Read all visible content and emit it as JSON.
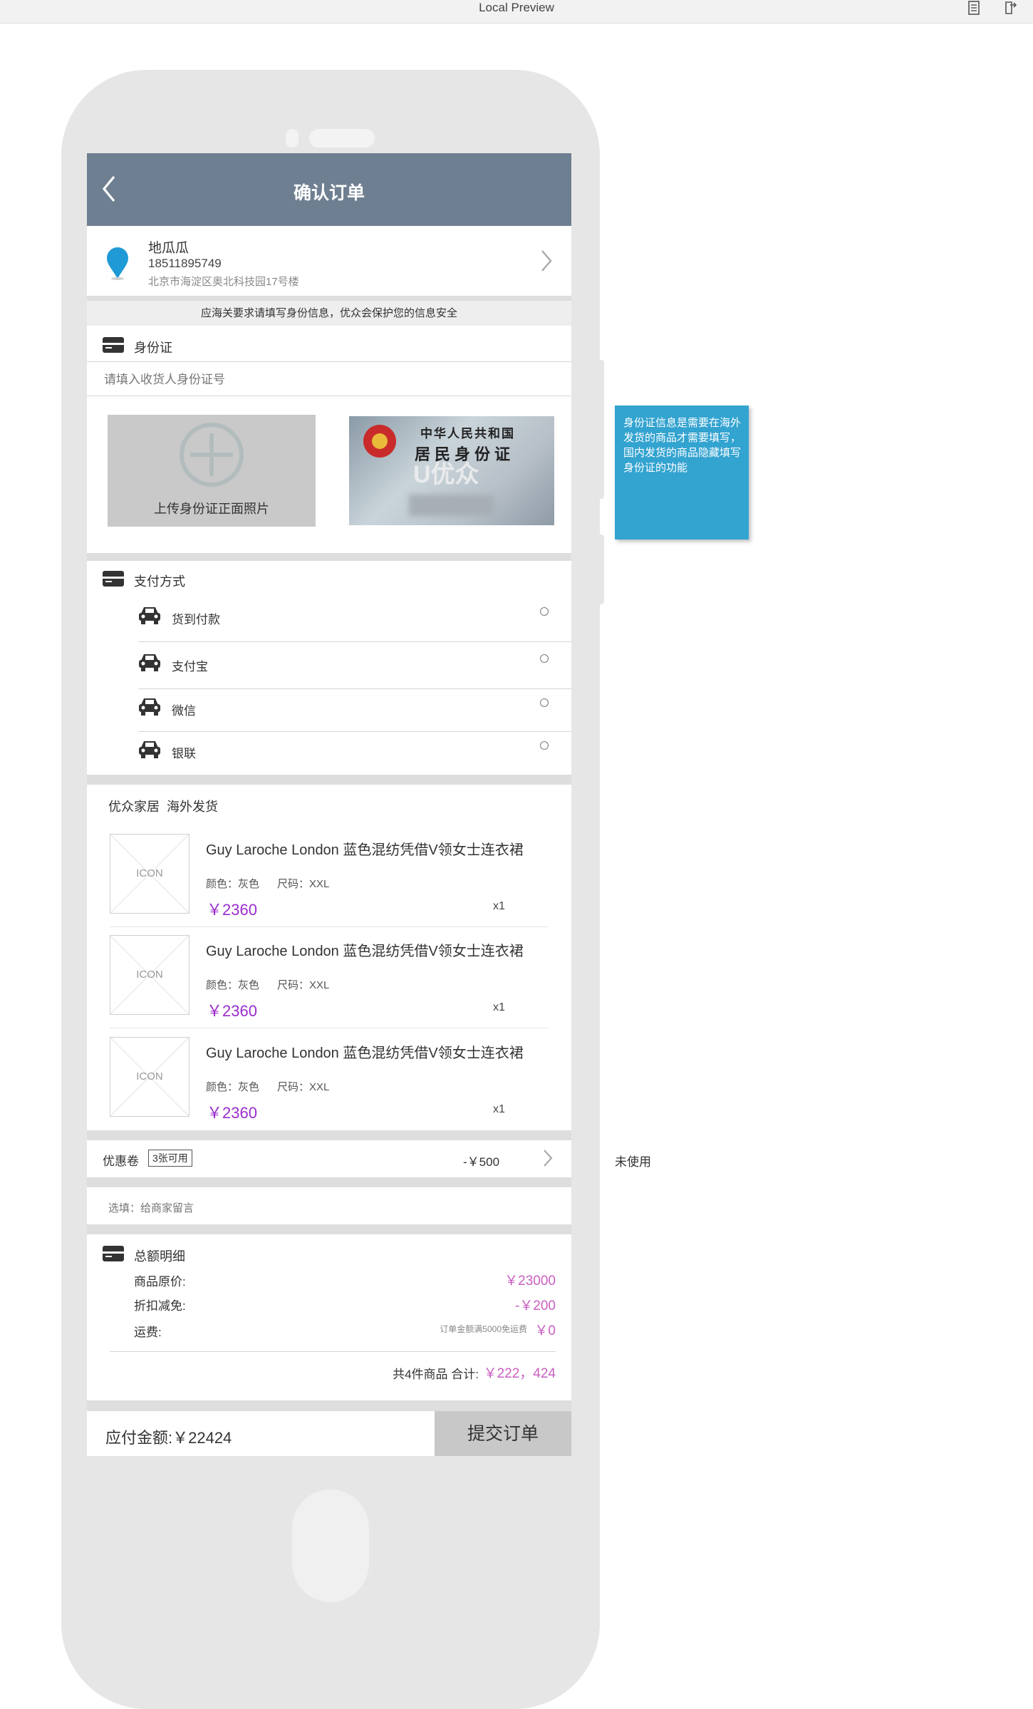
{
  "window": {
    "title": "Local Preview"
  },
  "header": {
    "title": "确认订单"
  },
  "address": {
    "name": "地瓜瓜",
    "phone": "18511895749",
    "address": "北京市海淀区奥北科技园17号楼"
  },
  "customs_notice": "应海关要求请填写身份信息，优众会保护您的信息安全",
  "id_section": {
    "title": "身份证",
    "input_placeholder": "请填入收货人身份证号",
    "upload_label": "上传身份证正面照片",
    "card_line1": "中华人民共和国",
    "card_line2": "居民身份证",
    "card_watermark": "U优众"
  },
  "payment": {
    "title": "支付方式",
    "options": [
      {
        "label": "货到付款"
      },
      {
        "label": "支付宝"
      },
      {
        "label": "微信"
      },
      {
        "label": "银联"
      }
    ]
  },
  "shop": {
    "name": "优众家居  海外发货",
    "items": [
      {
        "thumb": "ICON",
        "name": "Guy Laroche London 蓝色混纺凭借V领女士连衣裙",
        "color": "颜色：灰色",
        "size": "尺码：XXL",
        "price": "￥2360",
        "qty": "x1"
      },
      {
        "thumb": "ICON",
        "name": "Guy Laroche London 蓝色混纺凭借V领女士连衣裙",
        "color": "颜色：灰色",
        "size": "尺码：XXL",
        "price": "￥2360",
        "qty": "x1"
      },
      {
        "thumb": "ICON",
        "name": "Guy Laroche London 蓝色混纺凭借V领女士连衣裙",
        "color": "颜色：灰色",
        "size": "尺码：XXL",
        "price": "￥2360",
        "qty": "x1"
      }
    ]
  },
  "coupon": {
    "label": "优惠卷",
    "badge": "3张可用",
    "value": "-￥500"
  },
  "message": {
    "placeholder": "选填：给商家留言"
  },
  "summary": {
    "title": "总额明细",
    "original_label": "商品原价:",
    "original_value": "￥23000",
    "discount_label": "折扣减免:",
    "discount_value": "-￥200",
    "shipping_label": "运费:",
    "shipping_note": "订单金额满5000免运费",
    "shipping_value": "￥0",
    "total_label": "共4件商品 合计:",
    "total_value": "￥222，424"
  },
  "footer": {
    "payable": "应付金额:￥22424",
    "submit": "提交订单"
  },
  "annotations": {
    "id_note": "身份证信息是需要在海外发货的商品才需要填写，国内发货的商品隐藏填写身份证的功能",
    "coupon_note": "未使用"
  },
  "colors": {
    "header": "#6e7f91",
    "price": "#9b2dcc",
    "note": "#33a3d0",
    "pin": "#1f9ad6"
  }
}
